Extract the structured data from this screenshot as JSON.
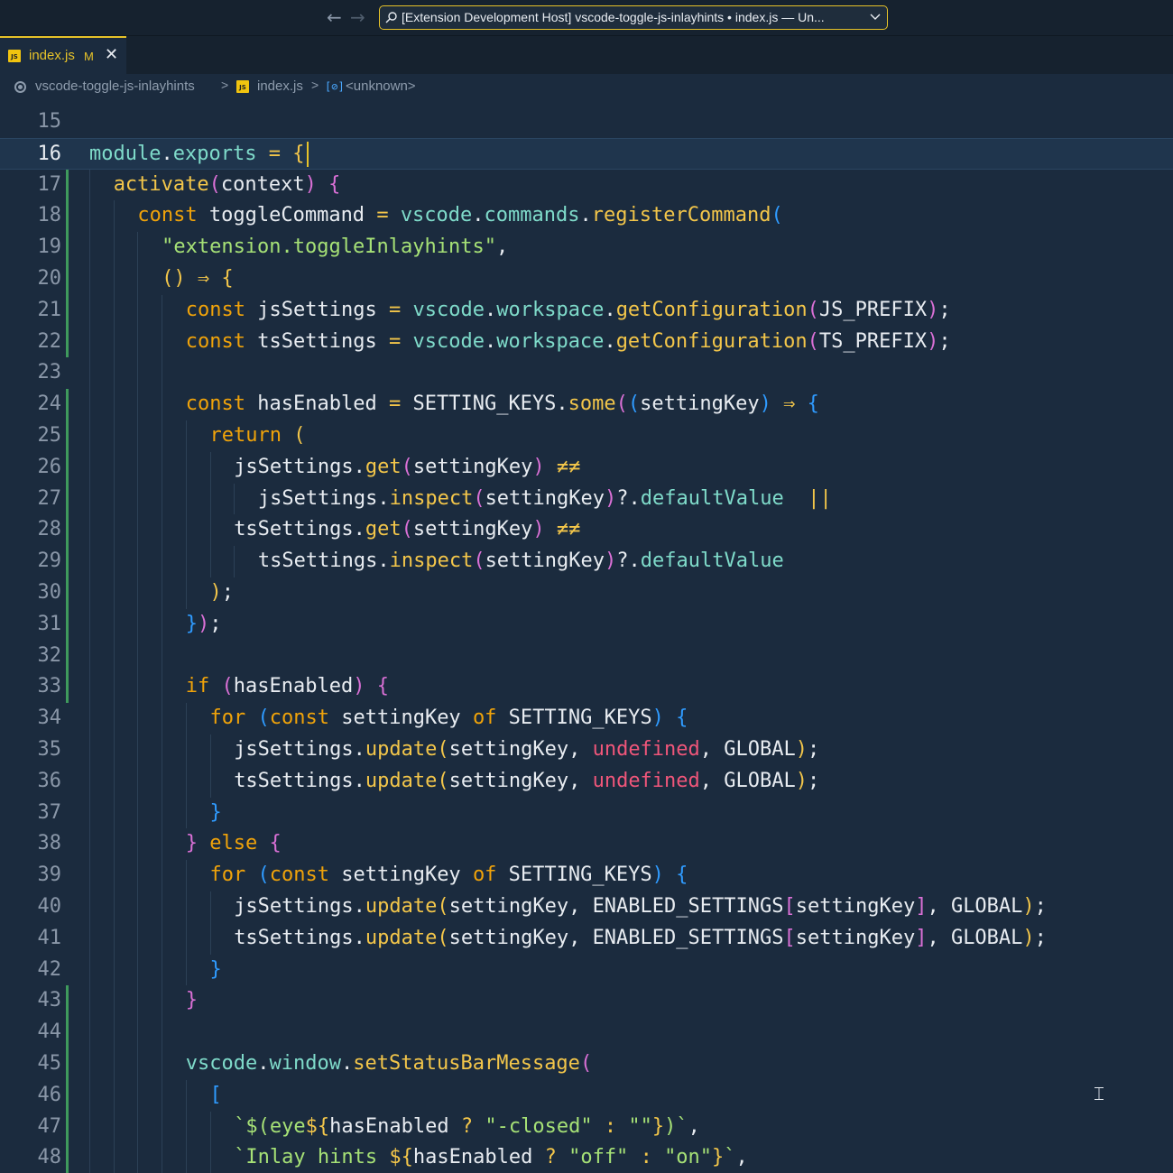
{
  "window": {
    "title": "[Extension Development Host] vscode-toggle-js-inlayhints • index.js — Un...",
    "search_icon": "search-icon",
    "chevron_icon": "chevron-down-icon"
  },
  "tab": {
    "icon": "js-file-icon",
    "icon_text": "JS",
    "label": "index.js",
    "badge": "M",
    "close": "✕"
  },
  "breadcrumb": {
    "items": [
      "vscode-toggle-js-inlayhints",
      "index.js",
      "<unknown>"
    ],
    "separator": ">"
  },
  "editor": {
    "current_line": 16,
    "lines": [
      {
        "n": "15",
        "indent": 0,
        "tokens": []
      },
      {
        "n": "16",
        "indent": 0,
        "tokens": [
          [
            "obj",
            "module"
          ],
          [
            "plain",
            "."
          ],
          [
            "prop",
            "exports"
          ],
          [
            "plain",
            " "
          ],
          [
            "op",
            "="
          ],
          [
            "plain",
            " "
          ],
          [
            "b1",
            "{"
          ]
        ]
      },
      {
        "n": "17",
        "indent": 1,
        "tokens": [
          [
            "fn",
            "activate"
          ],
          [
            "b2",
            "("
          ],
          [
            "plain",
            "context"
          ],
          [
            "b2",
            ")"
          ],
          [
            "plain",
            " "
          ],
          [
            "b2",
            "{"
          ]
        ]
      },
      {
        "n": "18",
        "indent": 2,
        "tokens": [
          [
            "kw",
            "const"
          ],
          [
            "plain",
            " toggleCommand "
          ],
          [
            "op",
            "="
          ],
          [
            "plain",
            " "
          ],
          [
            "obj",
            "vscode"
          ],
          [
            "plain",
            "."
          ],
          [
            "prop",
            "commands"
          ],
          [
            "plain",
            "."
          ],
          [
            "fn",
            "registerCommand"
          ],
          [
            "b3",
            "("
          ]
        ]
      },
      {
        "n": "19",
        "indent": 3,
        "tokens": [
          [
            "str",
            "\"extension.toggleInlayhints\""
          ],
          [
            "plain",
            ","
          ]
        ]
      },
      {
        "n": "20",
        "indent": 3,
        "tokens": [
          [
            "b1",
            "()"
          ],
          [
            "plain",
            " "
          ],
          [
            "op",
            "⇒"
          ],
          [
            "plain",
            " "
          ],
          [
            "b1",
            "{"
          ]
        ]
      },
      {
        "n": "21",
        "indent": 4,
        "tokens": [
          [
            "kw",
            "const"
          ],
          [
            "plain",
            " jsSettings "
          ],
          [
            "op",
            "="
          ],
          [
            "plain",
            " "
          ],
          [
            "obj",
            "vscode"
          ],
          [
            "plain",
            "."
          ],
          [
            "prop",
            "workspace"
          ],
          [
            "plain",
            "."
          ],
          [
            "fn",
            "getConfiguration"
          ],
          [
            "b2",
            "("
          ],
          [
            "plain",
            "JS_PREFIX"
          ],
          [
            "b2",
            ")"
          ],
          [
            "plain",
            ";"
          ]
        ]
      },
      {
        "n": "22",
        "indent": 4,
        "tokens": [
          [
            "kw",
            "const"
          ],
          [
            "plain",
            " tsSettings "
          ],
          [
            "op",
            "="
          ],
          [
            "plain",
            " "
          ],
          [
            "obj",
            "vscode"
          ],
          [
            "plain",
            "."
          ],
          [
            "prop",
            "workspace"
          ],
          [
            "plain",
            "."
          ],
          [
            "fn",
            "getConfiguration"
          ],
          [
            "b2",
            "("
          ],
          [
            "plain",
            "TS_PREFIX"
          ],
          [
            "b2",
            ")"
          ],
          [
            "plain",
            ";"
          ]
        ]
      },
      {
        "n": "23",
        "indent": 4,
        "tokens": []
      },
      {
        "n": "24",
        "indent": 4,
        "tokens": [
          [
            "kw",
            "const"
          ],
          [
            "plain",
            " hasEnabled "
          ],
          [
            "op",
            "="
          ],
          [
            "plain",
            " SETTING_KEYS."
          ],
          [
            "fn",
            "some"
          ],
          [
            "b2",
            "("
          ],
          [
            "b3",
            "("
          ],
          [
            "plain",
            "settingKey"
          ],
          [
            "b3",
            ")"
          ],
          [
            "plain",
            " "
          ],
          [
            "op",
            "⇒"
          ],
          [
            "plain",
            " "
          ],
          [
            "b3",
            "{"
          ]
        ]
      },
      {
        "n": "25",
        "indent": 5,
        "tokens": [
          [
            "kw",
            "return"
          ],
          [
            "plain",
            " "
          ],
          [
            "b1",
            "("
          ]
        ]
      },
      {
        "n": "26",
        "indent": 6,
        "tokens": [
          [
            "plain",
            "jsSettings."
          ],
          [
            "fn",
            "get"
          ],
          [
            "b2",
            "("
          ],
          [
            "plain",
            "settingKey"
          ],
          [
            "b2",
            ")"
          ],
          [
            "plain",
            " "
          ],
          [
            "op",
            "≠≠"
          ]
        ]
      },
      {
        "n": "27",
        "indent": 7,
        "tokens": [
          [
            "plain",
            "jsSettings."
          ],
          [
            "fn",
            "inspect"
          ],
          [
            "b2",
            "("
          ],
          [
            "plain",
            "settingKey"
          ],
          [
            "b2",
            ")"
          ],
          [
            "plain",
            "?."
          ],
          [
            "prop",
            "defaultValue"
          ],
          [
            "plain",
            "  "
          ],
          [
            "op",
            "||"
          ]
        ]
      },
      {
        "n": "28",
        "indent": 6,
        "tokens": [
          [
            "plain",
            "tsSettings."
          ],
          [
            "fn",
            "get"
          ],
          [
            "b2",
            "("
          ],
          [
            "plain",
            "settingKey"
          ],
          [
            "b2",
            ")"
          ],
          [
            "plain",
            " "
          ],
          [
            "op",
            "≠≠"
          ]
        ]
      },
      {
        "n": "29",
        "indent": 7,
        "tokens": [
          [
            "plain",
            "tsSettings."
          ],
          [
            "fn",
            "inspect"
          ],
          [
            "b2",
            "("
          ],
          [
            "plain",
            "settingKey"
          ],
          [
            "b2",
            ")"
          ],
          [
            "plain",
            "?."
          ],
          [
            "prop",
            "defaultValue"
          ]
        ]
      },
      {
        "n": "30",
        "indent": 5,
        "tokens": [
          [
            "b1",
            ")"
          ],
          [
            "plain",
            ";"
          ]
        ]
      },
      {
        "n": "31",
        "indent": 4,
        "tokens": [
          [
            "b3",
            "}"
          ],
          [
            "b2",
            ")"
          ],
          [
            "plain",
            ";"
          ]
        ]
      },
      {
        "n": "32",
        "indent": 4,
        "tokens": []
      },
      {
        "n": "33",
        "indent": 4,
        "tokens": [
          [
            "kw",
            "if"
          ],
          [
            "plain",
            " "
          ],
          [
            "b2",
            "("
          ],
          [
            "plain",
            "hasEnabled"
          ],
          [
            "b2",
            ")"
          ],
          [
            "plain",
            " "
          ],
          [
            "b2",
            "{"
          ]
        ]
      },
      {
        "n": "34",
        "indent": 5,
        "tokens": [
          [
            "kw",
            "for"
          ],
          [
            "plain",
            " "
          ],
          [
            "b3",
            "("
          ],
          [
            "kw",
            "const"
          ],
          [
            "plain",
            " settingKey "
          ],
          [
            "kw",
            "of"
          ],
          [
            "plain",
            " SETTING_KEYS"
          ],
          [
            "b3",
            ")"
          ],
          [
            "plain",
            " "
          ],
          [
            "b3",
            "{"
          ]
        ]
      },
      {
        "n": "35",
        "indent": 6,
        "tokens": [
          [
            "plain",
            "jsSettings."
          ],
          [
            "fn",
            "update"
          ],
          [
            "b1",
            "("
          ],
          [
            "plain",
            "settingKey, "
          ],
          [
            "undef",
            "undefined"
          ],
          [
            "plain",
            ", GLOBAL"
          ],
          [
            "b1",
            ")"
          ],
          [
            "plain",
            ";"
          ]
        ]
      },
      {
        "n": "36",
        "indent": 6,
        "tokens": [
          [
            "plain",
            "tsSettings."
          ],
          [
            "fn",
            "update"
          ],
          [
            "b1",
            "("
          ],
          [
            "plain",
            "settingKey, "
          ],
          [
            "undef",
            "undefined"
          ],
          [
            "plain",
            ", GLOBAL"
          ],
          [
            "b1",
            ")"
          ],
          [
            "plain",
            ";"
          ]
        ]
      },
      {
        "n": "37",
        "indent": 5,
        "tokens": [
          [
            "b3",
            "}"
          ]
        ]
      },
      {
        "n": "38",
        "indent": 4,
        "tokens": [
          [
            "b2",
            "}"
          ],
          [
            "plain",
            " "
          ],
          [
            "kw",
            "else"
          ],
          [
            "plain",
            " "
          ],
          [
            "b2",
            "{"
          ]
        ]
      },
      {
        "n": "39",
        "indent": 5,
        "tokens": [
          [
            "kw",
            "for"
          ],
          [
            "plain",
            " "
          ],
          [
            "b3",
            "("
          ],
          [
            "kw",
            "const"
          ],
          [
            "plain",
            " settingKey "
          ],
          [
            "kw",
            "of"
          ],
          [
            "plain",
            " SETTING_KEYS"
          ],
          [
            "b3",
            ")"
          ],
          [
            "plain",
            " "
          ],
          [
            "b3",
            "{"
          ]
        ]
      },
      {
        "n": "40",
        "indent": 6,
        "tokens": [
          [
            "plain",
            "jsSettings."
          ],
          [
            "fn",
            "update"
          ],
          [
            "b1",
            "("
          ],
          [
            "plain",
            "settingKey, ENABLED_SETTINGS"
          ],
          [
            "b2",
            "["
          ],
          [
            "plain",
            "settingKey"
          ],
          [
            "b2",
            "]"
          ],
          [
            "plain",
            ", GLOBAL"
          ],
          [
            "b1",
            ")"
          ],
          [
            "plain",
            ";"
          ]
        ]
      },
      {
        "n": "41",
        "indent": 6,
        "tokens": [
          [
            "plain",
            "tsSettings."
          ],
          [
            "fn",
            "update"
          ],
          [
            "b1",
            "("
          ],
          [
            "plain",
            "settingKey, ENABLED_SETTINGS"
          ],
          [
            "b2",
            "["
          ],
          [
            "plain",
            "settingKey"
          ],
          [
            "b2",
            "]"
          ],
          [
            "plain",
            ", GLOBAL"
          ],
          [
            "b1",
            ")"
          ],
          [
            "plain",
            ";"
          ]
        ]
      },
      {
        "n": "42",
        "indent": 5,
        "tokens": [
          [
            "b3",
            "}"
          ]
        ]
      },
      {
        "n": "43",
        "indent": 4,
        "tokens": [
          [
            "b2",
            "}"
          ]
        ]
      },
      {
        "n": "44",
        "indent": 4,
        "tokens": []
      },
      {
        "n": "45",
        "indent": 4,
        "tokens": [
          [
            "obj",
            "vscode"
          ],
          [
            "plain",
            "."
          ],
          [
            "prop",
            "window"
          ],
          [
            "plain",
            "."
          ],
          [
            "fn",
            "setStatusBarMessage"
          ],
          [
            "b2",
            "("
          ]
        ]
      },
      {
        "n": "46",
        "indent": 5,
        "tokens": [
          [
            "b3",
            "["
          ]
        ]
      },
      {
        "n": "47",
        "indent": 6,
        "tokens": [
          [
            "str",
            "`$(eye"
          ],
          [
            "op",
            "${"
          ],
          [
            "plain",
            "hasEnabled "
          ],
          [
            "op",
            "?"
          ],
          [
            "plain",
            " "
          ],
          [
            "str",
            "\"-closed\""
          ],
          [
            "plain",
            " "
          ],
          [
            "op",
            ":"
          ],
          [
            "plain",
            " "
          ],
          [
            "str",
            "\"\""
          ],
          [
            "op",
            "}"
          ],
          [
            "str",
            ")`"
          ],
          [
            "plain",
            ","
          ]
        ]
      },
      {
        "n": "48",
        "indent": 6,
        "tokens": [
          [
            "str",
            "`Inlay hints "
          ],
          [
            "op",
            "${"
          ],
          [
            "plain",
            "hasEnabled "
          ],
          [
            "op",
            "?"
          ],
          [
            "plain",
            " "
          ],
          [
            "str",
            "\"off\""
          ],
          [
            "plain",
            " "
          ],
          [
            "op",
            ":"
          ],
          [
            "plain",
            " "
          ],
          [
            "str",
            "\"on\""
          ],
          [
            "op",
            "}"
          ],
          [
            "str",
            "`"
          ],
          [
            "plain",
            ","
          ]
        ]
      }
    ]
  }
}
